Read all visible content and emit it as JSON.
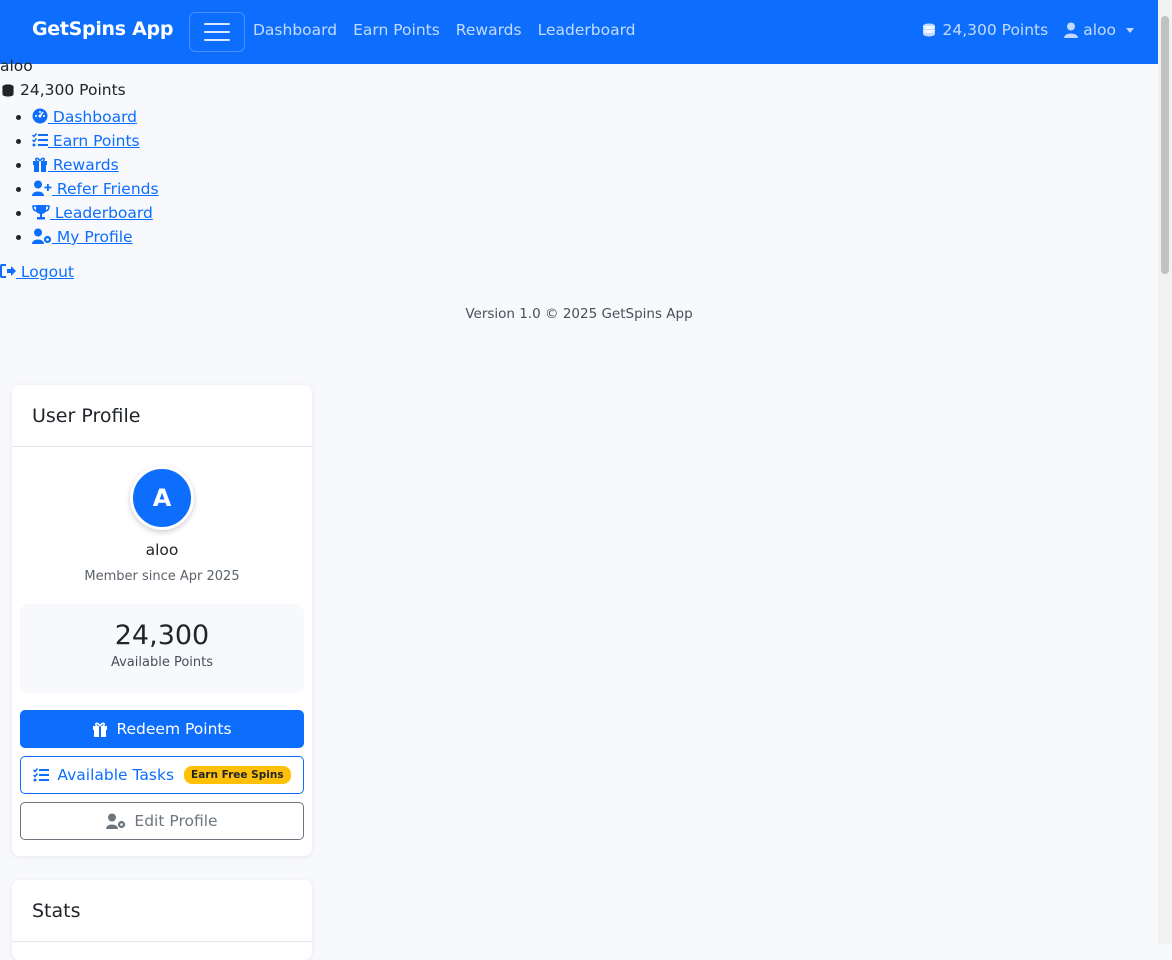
{
  "navbar": {
    "brand": "GetSpins App",
    "links": [
      "Dashboard",
      "Earn Points",
      "Rewards",
      "Leaderboard"
    ],
    "points": "24,300 Points",
    "user": "aloo"
  },
  "sidebar": {
    "username": "aloo",
    "points": "24,300 Points",
    "items": [
      {
        "label": " Dashboard",
        "icon": "dashboard-icon"
      },
      {
        "label": " Earn Points",
        "icon": "tasks-icon"
      },
      {
        "label": " Rewards",
        "icon": "gift-icon"
      },
      {
        "label": " Refer Friends",
        "icon": "user-plus-icon"
      },
      {
        "label": " Leaderboard",
        "icon": "trophy-icon"
      },
      {
        "label": " My Profile",
        "icon": "user-gear-icon"
      }
    ],
    "logout": " Logout",
    "version": "Version 1.0 © 2025 GetSpins App"
  },
  "profile_card": {
    "title": "User Profile",
    "avatar_letter": "A",
    "name": "aloo",
    "member_since": "Member since Apr 2025",
    "points_value": "24,300",
    "points_label": "Available Points",
    "redeem_label": "Redeem Points",
    "tasks_label": "Available Tasks",
    "tasks_badge": "Earn Free Spins",
    "edit_label": "Edit Profile"
  },
  "stats_card": {
    "title": "Stats"
  },
  "colors": {
    "primary": "#0d6efd",
    "badge": "#ffc107",
    "background": "#f8f9fc"
  }
}
